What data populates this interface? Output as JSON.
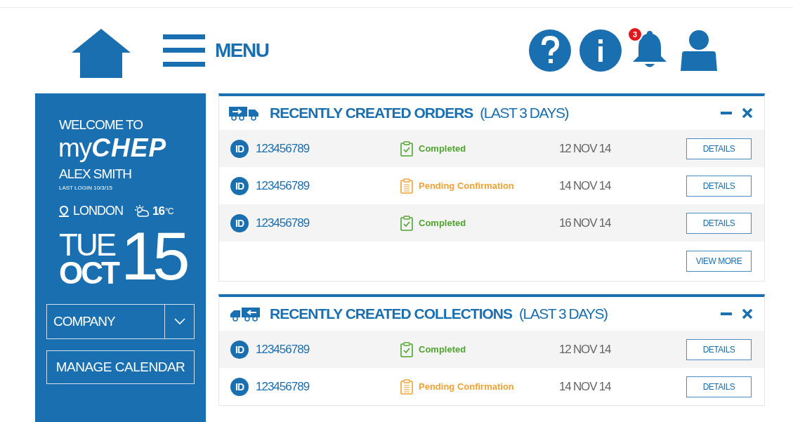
{
  "header": {
    "menu_label": "MENU",
    "notification_count": "3"
  },
  "sidebar": {
    "welcome": "WELCOME TO",
    "brand_prefix": "my",
    "brand_name": "CHEP",
    "user_name": "ALEX SMITH",
    "last_login": "LAST LOGIN 10/3/15",
    "city": "LONDON",
    "temperature": "16",
    "temperature_unit": "°C",
    "weekday": "TUE",
    "month": "OCT",
    "day": "15",
    "company_select": {
      "value": "COMPANY"
    },
    "manage_button": "MANAGE CALENDAR"
  },
  "panels": [
    {
      "kind": "orders",
      "title": "RECENTLY CREATED ORDERS",
      "subtitle": "(LAST 3 DAYS)",
      "rows": [
        {
          "id_badge": "ID",
          "id": "123456789",
          "kind": "completed",
          "status": "Completed",
          "date": "12 NOV 14",
          "button": "DETAILS"
        },
        {
          "id_badge": "ID",
          "id": "123456789",
          "kind": "pending",
          "status": "Pending Confirmation",
          "date": "14 NOV 14",
          "button": "DETAILS"
        },
        {
          "id_badge": "ID",
          "id": "123456789",
          "kind": "completed",
          "status": "Completed",
          "date": "16 NOV 14",
          "button": "DETAILS"
        }
      ],
      "view_more": "VIEW MORE"
    },
    {
      "kind": "collections",
      "title": "RECENTLY CREATED COLLECTIONS",
      "subtitle": "(LAST 3 DAYS)",
      "rows": [
        {
          "id_badge": "ID",
          "id": "123456789",
          "kind": "completed",
          "status": "Completed",
          "date": "12 NOV 14",
          "button": "DETAILS"
        },
        {
          "id_badge": "ID",
          "id": "123456789",
          "kind": "pending",
          "status": "Pending Confirmation",
          "date": "14 NOV 14",
          "button": "DETAILS"
        }
      ]
    }
  ]
}
